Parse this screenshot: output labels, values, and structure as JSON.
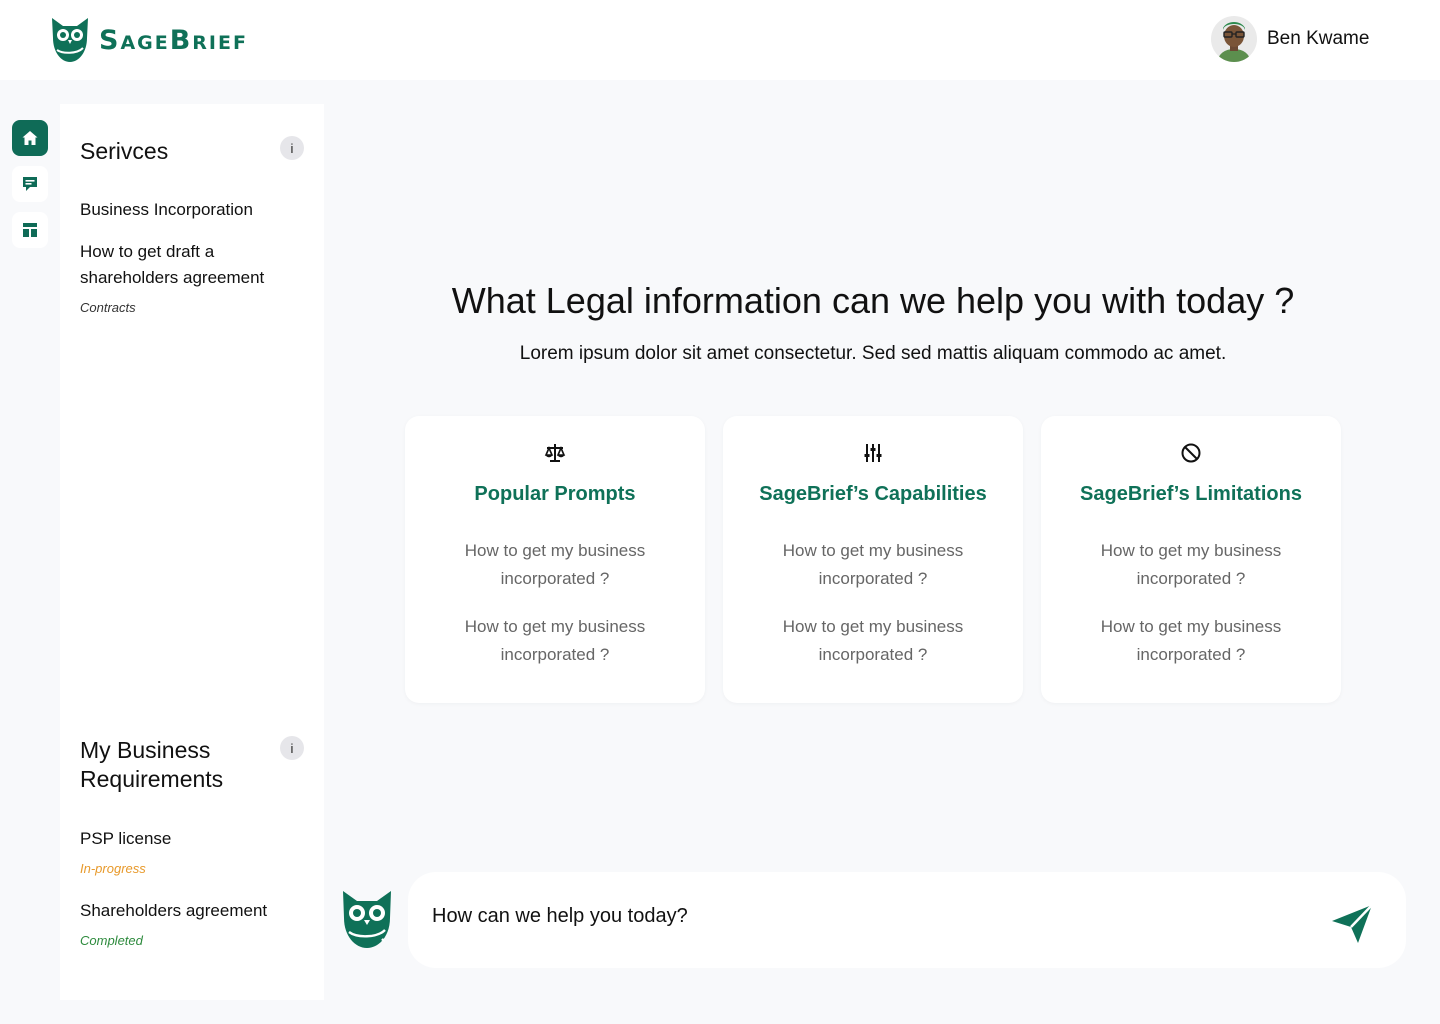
{
  "brand": {
    "name": "SageBrief",
    "color": "#0f7158"
  },
  "user": {
    "name": "Ben Kwame"
  },
  "rail": [
    {
      "icon": "home-icon",
      "active": true
    },
    {
      "icon": "chat-icon",
      "active": false
    },
    {
      "icon": "dashboard-icon",
      "active": false
    }
  ],
  "sidebar": {
    "services": {
      "title": "Serivces",
      "info_label": "i",
      "items": [
        {
          "label": "Business Incorporation"
        },
        {
          "label": "How to get draft a shareholders agreement",
          "tag": "Contracts"
        }
      ]
    },
    "requirements": {
      "title": "My Business Requirements",
      "info_label": "i",
      "items": [
        {
          "label": "PSP license",
          "status": "In-progress",
          "status_color": "#e89a2c"
        },
        {
          "label": "Shareholders agreement",
          "status": "Completed",
          "status_color": "#2e8b3e"
        }
      ]
    }
  },
  "main": {
    "headline": "What Legal information can we help you with today ?",
    "subline": "Lorem ipsum dolor sit amet consectetur. Sed sed mattis aliquam commodo ac amet.",
    "cards": [
      {
        "icon": "scales-icon",
        "title": "Popular Prompts",
        "questions": [
          "How to get my business incorporated ?",
          "How to get my business incorporated ?"
        ]
      },
      {
        "icon": "sliders-icon",
        "title": "SageBrief’s Capabilities",
        "questions": [
          "How to get my business incorporated ?",
          "How to get my business incorporated ?"
        ]
      },
      {
        "icon": "block-icon",
        "title": "SageBrief’s Limitations",
        "questions": [
          "How to get my business incorporated ?",
          "How to get my business incorporated ?"
        ]
      }
    ]
  },
  "chat": {
    "placeholder": "How can we help you today?",
    "send_icon": "send-icon"
  }
}
